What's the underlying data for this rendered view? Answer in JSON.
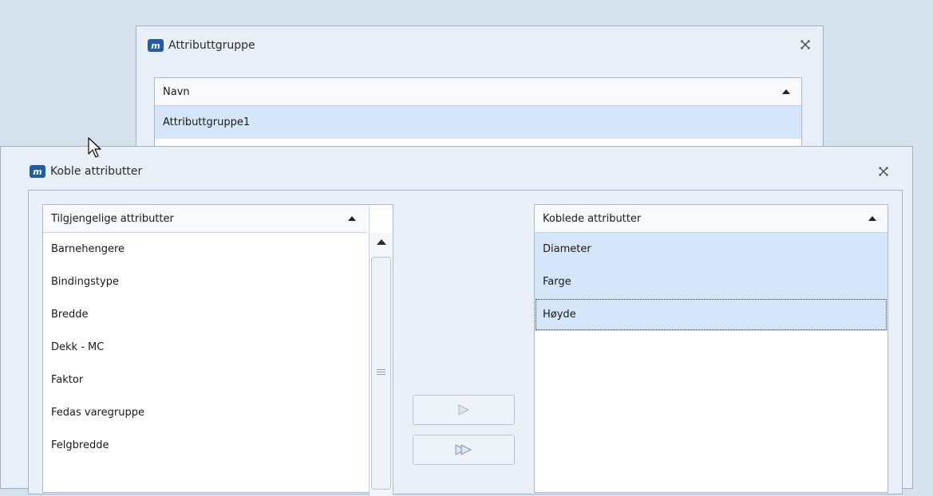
{
  "back_window": {
    "title": "Attributtgruppe",
    "column_header": "Navn",
    "rows": [
      "Attributtgruppe1"
    ]
  },
  "front_window": {
    "title": "Koble attributter",
    "available": {
      "header": "Tilgjengelige attributter",
      "items": [
        "Barnehengere",
        "Bindingstype",
        "Bredde",
        "Dekk - MC",
        "Faktor",
        "Fedas varegruppe",
        "Felgbredde"
      ]
    },
    "linked": {
      "header": "Koblede attributter",
      "items": [
        "Diameter",
        "Farge",
        "Høyde"
      ]
    }
  },
  "icons": [
    "app-logo-icon",
    "close-icon",
    "sort-ascending-icon",
    "scroll-up-icon",
    "move-right-icon",
    "move-all-right-icon",
    "mouse-cursor-icon"
  ],
  "colors": {
    "background": "#d6e1ee",
    "window": "#e9eff7",
    "selected_row": "#d6e6fa",
    "brand": "#1f5da8"
  }
}
